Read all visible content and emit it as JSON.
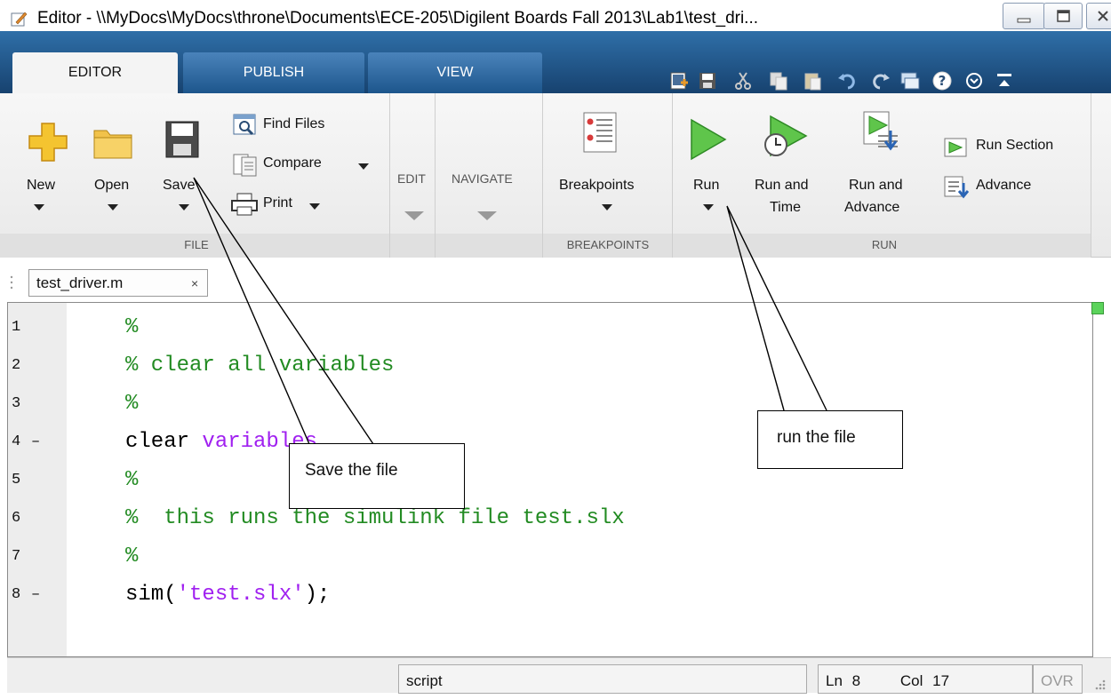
{
  "window": {
    "title": "Editor - \\\\MyDocs\\MyDocs\\throne\\Documents\\ECE-205\\Digilent Boards Fall 2013\\Lab1\\test_dri..."
  },
  "ribbon_tabs": [
    "EDITOR",
    "PUBLISH",
    "VIEW"
  ],
  "file_group": {
    "new": "New",
    "open": "Open",
    "save": "Save",
    "find_files": "Find Files",
    "compare": "Compare",
    "print": "Print",
    "label": "FILE"
  },
  "edit_group": {
    "label": "EDIT"
  },
  "navigate_group": {
    "label": "NAVIGATE"
  },
  "breakpoints_group": {
    "button": "Breakpoints",
    "label": "BREAKPOINTS"
  },
  "run_group": {
    "run": "Run",
    "run_and_time_1": "Run and",
    "run_and_time_2": "Time",
    "run_and_advance_1": "Run and",
    "run_and_advance_2": "Advance",
    "run_section": "Run Section",
    "advance": "Advance",
    "label": "RUN"
  },
  "doc_tab": {
    "name": "test_driver.m",
    "close": "×"
  },
  "code_lines": [
    {
      "num": "1",
      "dash": "",
      "text": "%"
    },
    {
      "num": "2",
      "dash": "",
      "text": "% clear all variables"
    },
    {
      "num": "3",
      "dash": "",
      "text": "%"
    },
    {
      "num": "4",
      "dash": "–",
      "kw": "clear ",
      "str": "variables"
    },
    {
      "num": "5",
      "dash": "",
      "text": "%"
    },
    {
      "num": "6",
      "dash": "",
      "text": "%  this runs the simulink file test.slx"
    },
    {
      "num": "7",
      "dash": "",
      "text": "%"
    },
    {
      "num": "8",
      "dash": "–",
      "kw": "sim(",
      "str": "'test.slx'",
      "kw2": ");"
    }
  ],
  "status": {
    "mode": "script",
    "ln_label": "Ln",
    "ln": "8",
    "col_label": "Col",
    "col": "17",
    "ovr": "OVR"
  },
  "callouts": {
    "save": "Save the file",
    "run": "run the file"
  }
}
